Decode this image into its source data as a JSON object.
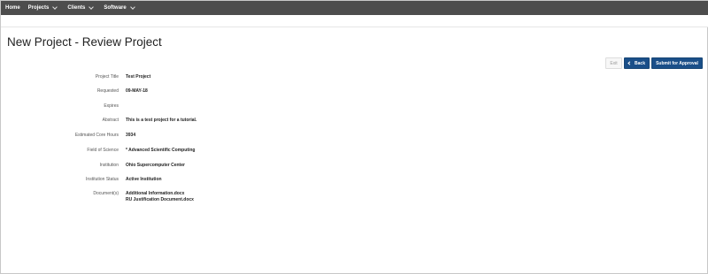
{
  "nav": {
    "items": [
      {
        "label": "Home",
        "has_menu": false
      },
      {
        "label": "Projects",
        "has_menu": true
      },
      {
        "label": "Clients",
        "has_menu": true
      },
      {
        "label": "Software",
        "has_menu": true
      }
    ]
  },
  "page": {
    "title": "New Project - Review Project"
  },
  "actions": {
    "exit_label": "Exit",
    "back_label": "Back",
    "submit_label": "Submit for Approval"
  },
  "fields": {
    "project_title": {
      "label": "Project Title",
      "value": "Test Project"
    },
    "requested": {
      "label": "Requested",
      "value": "09-MAY-18"
    },
    "expires": {
      "label": "Expires",
      "value": ""
    },
    "abstract": {
      "label": "Abstract",
      "value": "This is a test project for a tutorial."
    },
    "core_hours": {
      "label": "Estimated Core Hours",
      "value": "3934"
    },
    "field_of_science": {
      "label": "Field of Science",
      "value": "* Advanced Scientific Computing"
    },
    "institution": {
      "label": "Institution",
      "value": "Ohio Supercomputer Center"
    },
    "institution_status": {
      "label": "Institution Status",
      "value": "Active Institution"
    },
    "documents": {
      "label": "Document(s)",
      "items": [
        "Additional Information.docx",
        "RU Justification Document.docx"
      ]
    }
  },
  "colors": {
    "nav_bg": "#4d4d4d",
    "primary_button": "#1a4f89"
  }
}
